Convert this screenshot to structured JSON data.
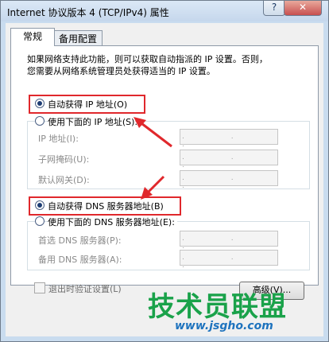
{
  "window": {
    "title": "Internet 协议版本 4 (TCP/IPv4) 属性",
    "help_label": "?",
    "close_label": "✕"
  },
  "tabs": [
    {
      "label": "常规"
    },
    {
      "label": "备用配置"
    }
  ],
  "description": {
    "line1": "如果网络支持此功能，则可以获取自动指派的 IP 设置。否则，",
    "line2": "您需要从网络系统管理员处获得适当的 IP 设置。"
  },
  "ip": {
    "auto_label": "自动获得 IP 地址(O)",
    "manual_label": "使用下面的 IP 地址(S):",
    "fields": [
      {
        "label": "IP 地址(I):",
        "value": ". . ."
      },
      {
        "label": "子网掩码(U):",
        "value": ". . ."
      },
      {
        "label": "默认网关(D):",
        "value": ". . ."
      }
    ]
  },
  "dns": {
    "auto_label": "自动获得 DNS 服务器地址(B)",
    "manual_label": "使用下面的 DNS 服务器地址(E):",
    "fields": [
      {
        "label": "首选 DNS 服务器(P):",
        "value": ". . ."
      },
      {
        "label": "备用 DNS 服务器(A):",
        "value": ". . ."
      }
    ]
  },
  "footer": {
    "validate_label": "退出时验证设置(L)",
    "advanced_label": "高级(V)..."
  },
  "watermark": {
    "title": "技术员联盟",
    "url": "www.jsgho.com"
  },
  "colors": {
    "highlight": "#e0282c",
    "accent": "#1e3d74"
  }
}
